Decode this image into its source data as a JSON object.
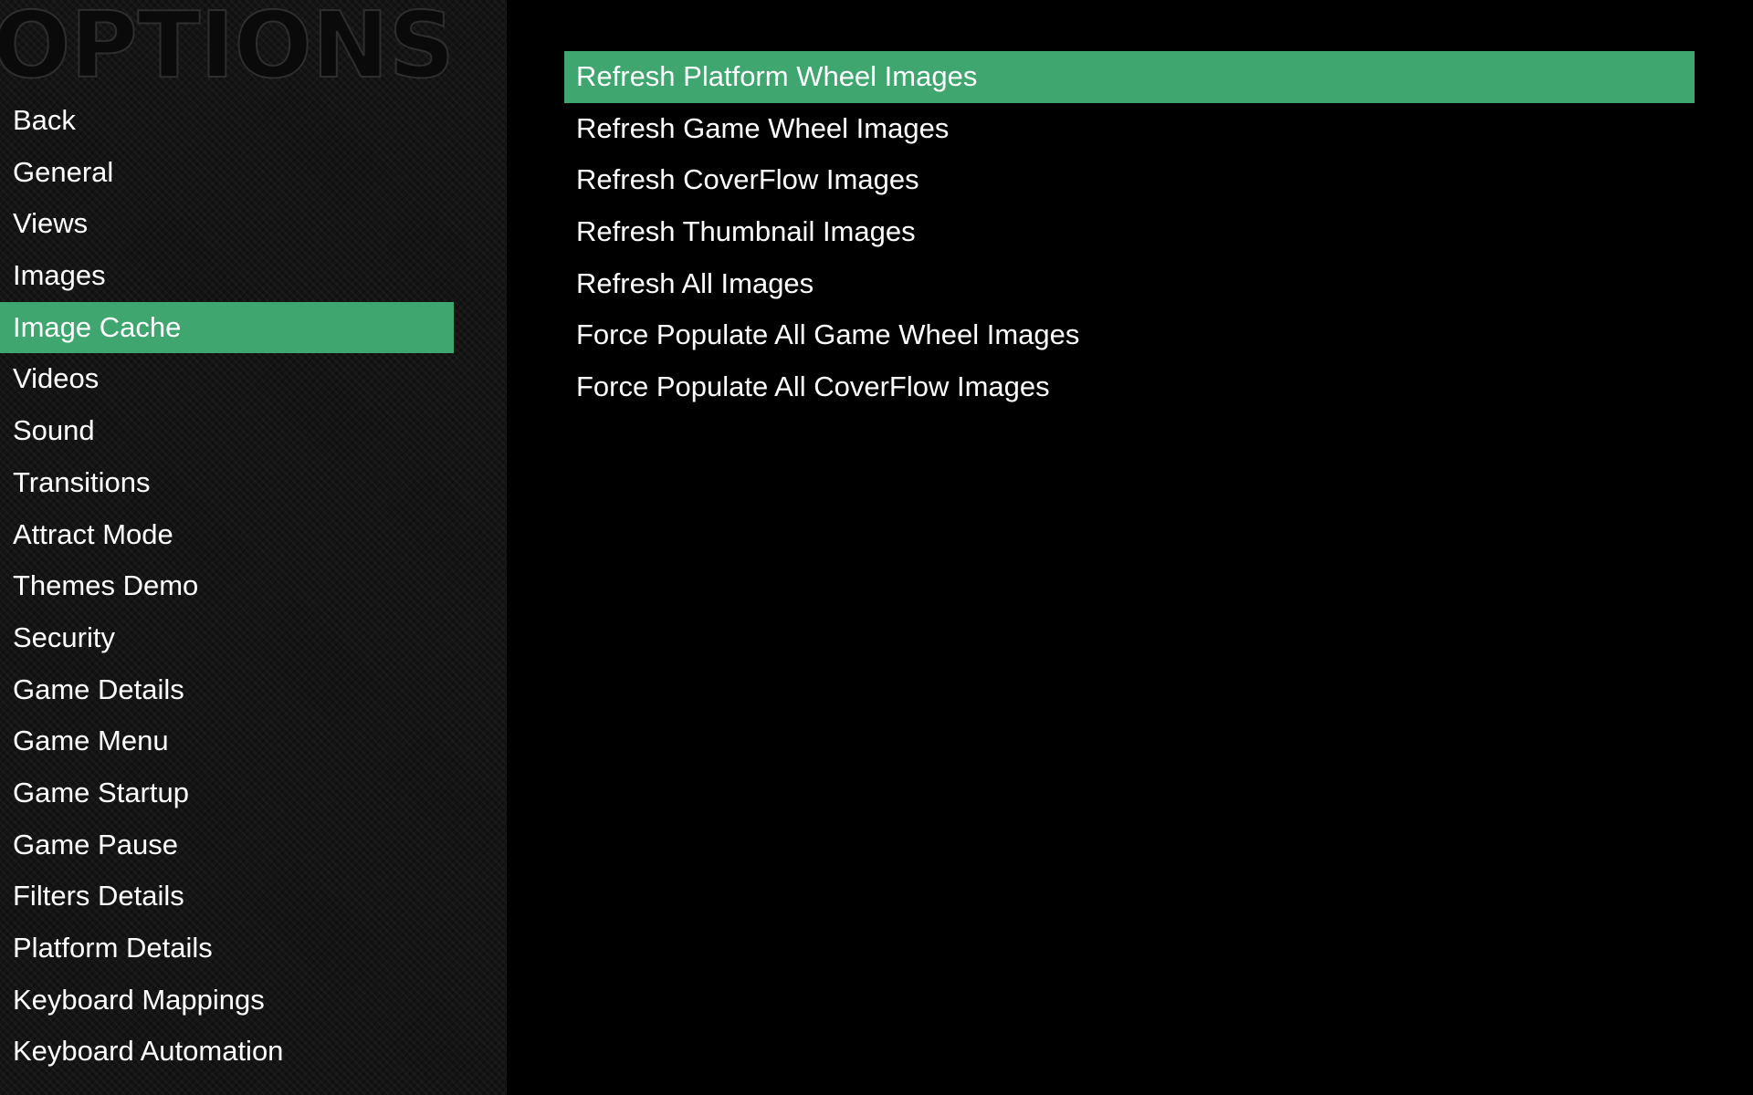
{
  "theme": {
    "accent": "#3ea66e",
    "background": "#000000",
    "sidebar_background": "#141414",
    "text": "#ffffff"
  },
  "header": {
    "logo_text": "OPTIONS"
  },
  "sidebar": {
    "selected_index": 4,
    "items": [
      {
        "label": "Back"
      },
      {
        "label": "General"
      },
      {
        "label": "Views"
      },
      {
        "label": "Images"
      },
      {
        "label": "Image Cache"
      },
      {
        "label": "Videos"
      },
      {
        "label": "Sound"
      },
      {
        "label": "Transitions"
      },
      {
        "label": "Attract Mode"
      },
      {
        "label": "Themes Demo"
      },
      {
        "label": "Security"
      },
      {
        "label": "Game Details"
      },
      {
        "label": "Game Menu"
      },
      {
        "label": "Game Startup"
      },
      {
        "label": "Game Pause"
      },
      {
        "label": "Filters Details"
      },
      {
        "label": "Platform Details"
      },
      {
        "label": "Keyboard Mappings"
      },
      {
        "label": "Keyboard Automation"
      }
    ]
  },
  "main": {
    "selected_index": 0,
    "items": [
      {
        "label": "Refresh Platform Wheel Images"
      },
      {
        "label": "Refresh Game Wheel Images"
      },
      {
        "label": "Refresh CoverFlow Images"
      },
      {
        "label": "Refresh Thumbnail Images"
      },
      {
        "label": "Refresh All Images"
      },
      {
        "label": "Force Populate All Game Wheel Images"
      },
      {
        "label": "Force Populate All CoverFlow Images"
      }
    ]
  }
}
